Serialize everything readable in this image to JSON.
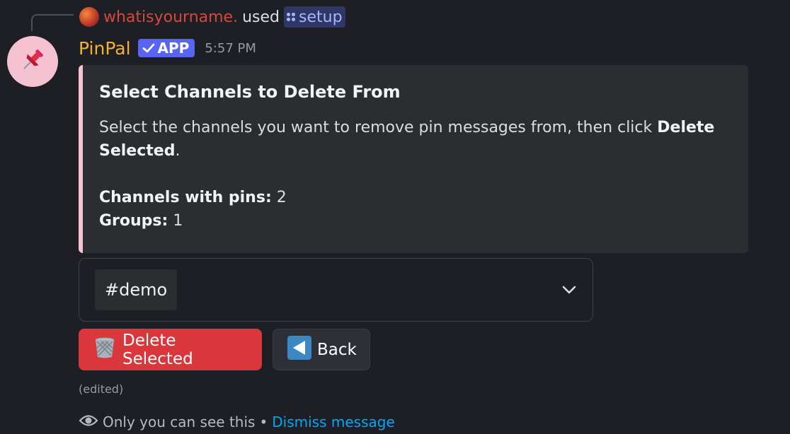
{
  "reply": {
    "username": "whatisyourname.",
    "used": "used",
    "command": "setup"
  },
  "message": {
    "bot_name": "PinPal",
    "app_tag": "APP",
    "timestamp": "5:57 PM",
    "avatar_icon": "pushpin-icon"
  },
  "embed": {
    "accent_color": "#f5c2d2",
    "title": "Select Channels to Delete From",
    "desc_prefix": "Select the channels you want to remove pin messages from, then click ",
    "desc_bold": "Delete Selected",
    "desc_suffix": ".",
    "channels_label": "Channels with pins:",
    "channels_value": "2",
    "groups_label": "Groups:",
    "groups_value": "1"
  },
  "select": {
    "selected_value": "#demo"
  },
  "buttons": {
    "delete_label": "Delete Selected",
    "delete_icon": "wastebasket-icon",
    "back_label": "Back",
    "back_icon": "back-arrow-icon"
  },
  "edited_label": "(edited)",
  "footer": {
    "only_you": "Only you can see this",
    "separator": "•",
    "dismiss": "Dismiss message"
  },
  "colors": {
    "background": "#1e1f24",
    "bot_name": "#f0b232",
    "reply_user": "#d24a3f",
    "app_tag": "#5865f2",
    "danger": "#da373c",
    "link": "#00a8fc"
  }
}
